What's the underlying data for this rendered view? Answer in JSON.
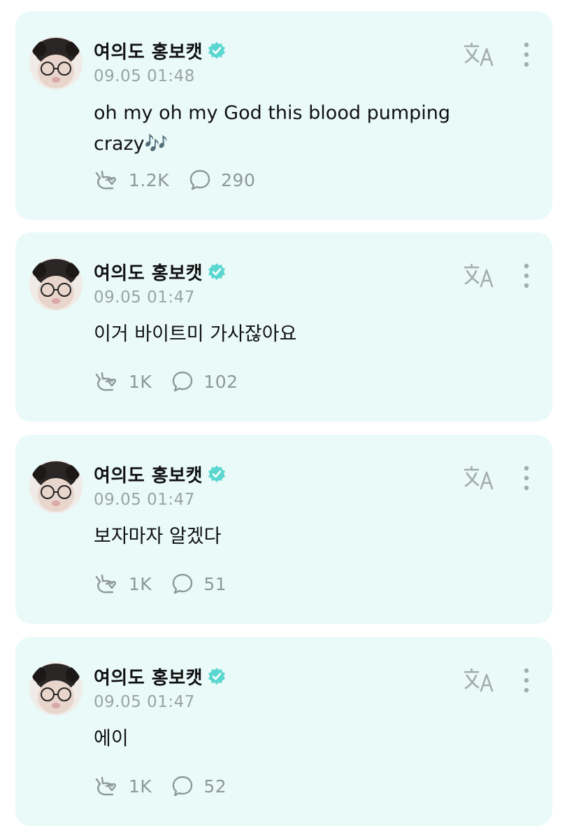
{
  "posts": [
    {
      "author": "여의도 홍보캣",
      "time": "09.05 01:48",
      "text": "oh my oh my God this blood pumping crazy🎶",
      "likes": "1.2K",
      "comments": "290"
    },
    {
      "author": "여의도 홍보캣",
      "time": "09.05 01:47",
      "text": "이거 바이트미 가사잖아요",
      "likes": "1K",
      "comments": "102"
    },
    {
      "author": "여의도 홍보캣",
      "time": "09.05 01:47",
      "text": "보자마자 알겠다",
      "likes": "1K",
      "comments": "51"
    },
    {
      "author": "여의도 홍보캣",
      "time": "09.05 01:47",
      "text": "에이",
      "likes": "1K",
      "comments": "52"
    }
  ],
  "icons": {
    "verified": "verified-badge-icon",
    "translate": "translate-icon",
    "more": "more-vertical-icon",
    "like": "heart-hand-icon",
    "comment": "speech-bubble-icon"
  },
  "colors": {
    "card_background": "#e9faf8",
    "verified": "#5cd6d0",
    "muted": "#9aa4a6"
  }
}
